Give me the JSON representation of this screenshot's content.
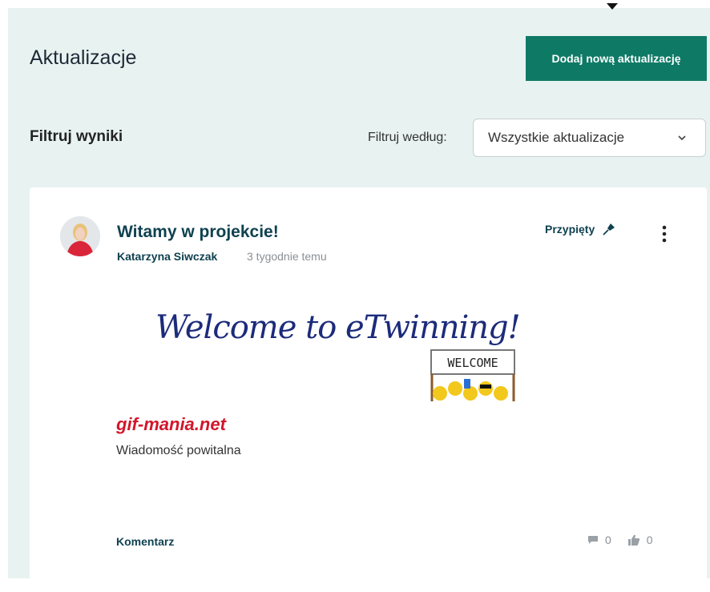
{
  "header": {
    "title": "Aktualizacje",
    "add_button": "Dodaj nową aktualizację"
  },
  "filter": {
    "heading": "Filtruj wyniki",
    "label": "Filtruj według:",
    "selected": "Wszystkie aktualizacje"
  },
  "post": {
    "title": "Witamy w projekcie!",
    "author": "Katarzyna Siwczak",
    "time": "3 tygodnie temu",
    "pinned_label": "Przypięty",
    "image_text": "Welcome to eTwinning!",
    "sign_text": "WELCOME",
    "gif_credit": "gif-mania.net",
    "message": "Wiadomość powitalna",
    "comment_label": "Komentarz",
    "comment_count": "0",
    "like_count": "0"
  },
  "colors": {
    "accent": "#0e7a66",
    "panel_bg": "#e8f3f1",
    "text_dark": "#0f4150",
    "muted": "#8a8f94",
    "gif_red": "#d3162b"
  }
}
